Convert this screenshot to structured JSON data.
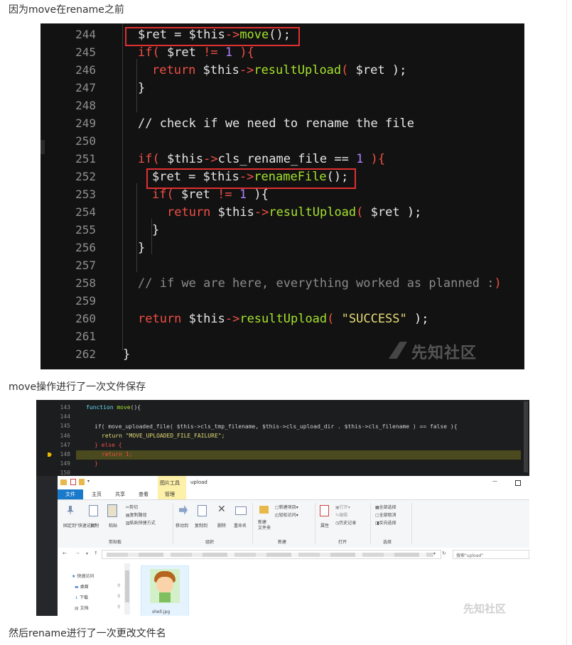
{
  "paragraphs": {
    "p1": "因为move在rename之前",
    "p2": "move操作进行了一次文件保存",
    "p3": "然后rename进行了一次更改文件名"
  },
  "code1": {
    "line_numbers": [
      "244",
      "245",
      "246",
      "247",
      "248",
      "249",
      "250",
      "251",
      "252",
      "253",
      "254",
      "255",
      "256",
      "257",
      "258",
      "259",
      "260",
      "261",
      "262"
    ],
    "l244": {
      "a": "$ret = $this",
      "arrow": "->",
      "fn": "move",
      "b": "();"
    },
    "l245": {
      "kw": "if(",
      "a": " $ret ",
      "op": "!=",
      "sp": " ",
      "num": "1",
      "b": " ){"
    },
    "l246": {
      "kw": "return",
      "a": " $this",
      "arrow": "->",
      "fn": "resultUpload",
      "p": "(",
      "b": " $ret ",
      "c": ");"
    },
    "l247": "}",
    "l249": "// check if we need to rename the file",
    "l251": {
      "kw": "if(",
      "a": " $this",
      "arrow": "->",
      "b": "cls_rename_file == ",
      "num": "1",
      "c": " ){"
    },
    "l252": {
      "a": "$ret = $this",
      "arrow": "->",
      "fn": "renameFile",
      "b": "();"
    },
    "l253": {
      "kw": "if(",
      "a": " $ret ",
      "op": "!=",
      "sp": " ",
      "num": "1",
      "b": " ){"
    },
    "l254": {
      "kw": "return",
      "a": " $this",
      "arrow": "->",
      "fn": "resultUpload",
      "p": "(",
      "b": " $ret ",
      "c": ");"
    },
    "l255": "}",
    "l256": "}",
    "l258": {
      "cm": "// if we are here, everything worked as planned :",
      "paren": ")"
    },
    "l260": {
      "kw": "return",
      "a": " $this",
      "arrow": "->",
      "fn": "resultUpload",
      "p": "(",
      "str": " \"SUCCESS\" ",
      "c": ");"
    },
    "l262": "}",
    "watermark": "先知社区"
  },
  "code2": {
    "line_numbers": [
      "143",
      "144",
      "145",
      "146",
      "147",
      "148",
      "149",
      "150"
    ],
    "l143": "function move(){",
    "l145": "if( move_uploaded_file( $this->cls_tmp_filename, $this->cls_upload_dir . $this->cls_filename ) == false ){",
    "l146": "return \"MOVE_UPLOADED_FILE_FAILURE\";",
    "l147": "} else {",
    "l148": "return 1;",
    "l149": "}"
  },
  "explorer": {
    "context_tab": "图片工具",
    "window_title": "upload",
    "tabs": [
      "文件",
      "主页",
      "共享",
      "查看",
      "管理"
    ],
    "groups": [
      "剪贴板",
      "组织",
      "新建",
      "打开",
      "选择"
    ],
    "clipboard": {
      "pin": "固定到\"快速访问\"",
      "copy": "复制",
      "paste": "粘贴",
      "cut": "剪切",
      "copy_path": "复制路径",
      "paste_shortcut": "粘贴快捷方式"
    },
    "organize": {
      "move_to": "移动到",
      "copy_to": "复制到",
      "delete": "删除",
      "rename": "重命名"
    },
    "new": {
      "new_folder": "新建\n文件夹",
      "new_item": "新建项目",
      "easy_access": "轻松访问"
    },
    "open": {
      "properties": "属性",
      "open": "打开",
      "edit": "编辑",
      "history": "历史记录"
    },
    "select": {
      "select_all": "全部选择",
      "select_none": "全部取消",
      "invert": "反向选择"
    },
    "search_placeholder": "搜索\"upload\"",
    "nav_items": [
      "快速访问",
      "桌面",
      "下载",
      "文档"
    ],
    "file_name": "shell.jpg",
    "watermark": "先知社区",
    "colors": {
      "file_tab": "#1979ca",
      "context_tab": "#fdf0a8"
    }
  }
}
